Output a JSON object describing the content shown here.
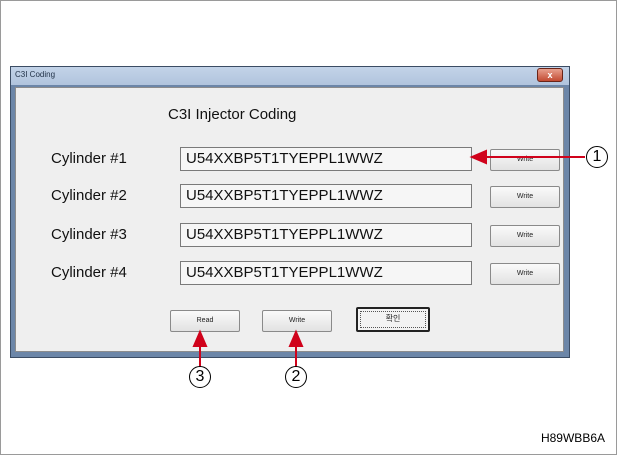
{
  "window": {
    "title": "C3I Coding",
    "close_label": "x"
  },
  "dialog": {
    "heading": "C3I Injector Coding",
    "rows": [
      {
        "label": "Cylinder #1",
        "code": "U54XXBP5T1TYEPPL1WWZ",
        "button": "Write"
      },
      {
        "label": "Cylinder #2",
        "code": "U54XXBP5T1TYEPPL1WWZ",
        "button": "Write"
      },
      {
        "label": "Cylinder #3",
        "code": "U54XXBP5T1TYEPPL1WWZ",
        "button": "Write"
      },
      {
        "label": "Cylinder #4",
        "code": "U54XXBP5T1TYEPPL1WWZ",
        "button": "Write"
      }
    ],
    "buttons": {
      "read": "Read",
      "write": "Write",
      "confirm": "확인"
    }
  },
  "callouts": {
    "one": "1",
    "two": "2",
    "three": "3"
  },
  "figure_code": "H89WBB6A",
  "colors": {
    "window_frame": "#6c86a8",
    "client_bg": "#efefef",
    "arrow": "#d0021b"
  }
}
